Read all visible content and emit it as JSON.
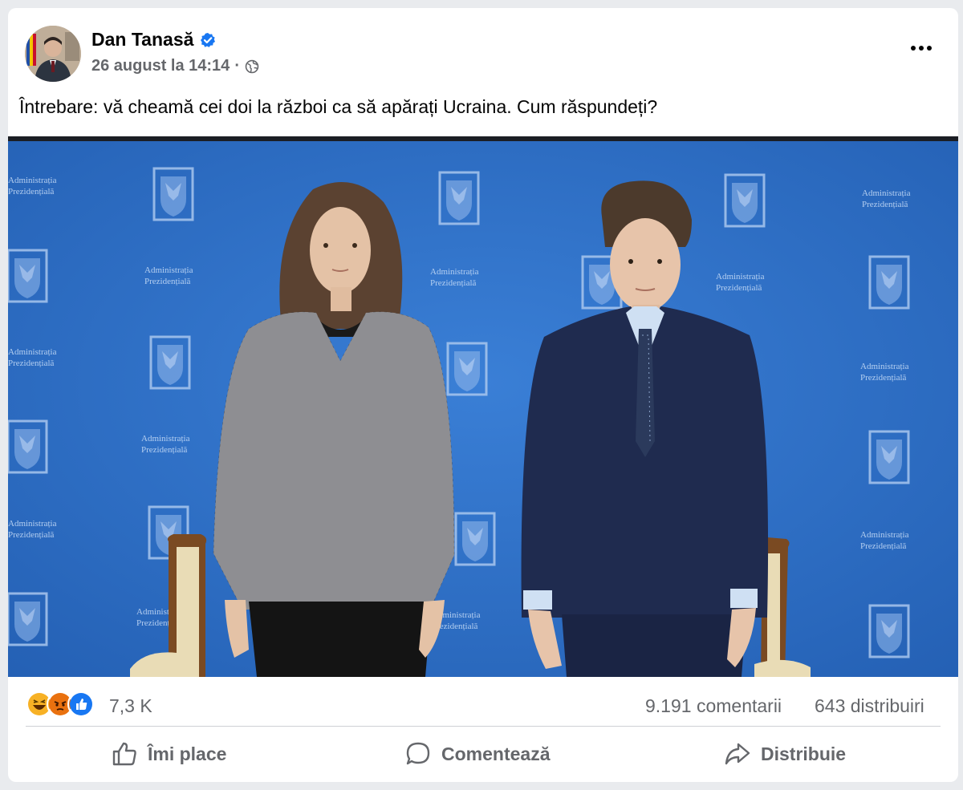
{
  "post": {
    "author": "Dan Tanasă",
    "timestamp": "26 august la 14:14",
    "separator": "·",
    "privacy_icon": "globe-icon",
    "verified_icon": "verified-badge-icon",
    "more_icon": "more-options-icon",
    "message": "Întrebare: vă cheamă cei doi la război ca să apărați Ucraina. Cum răspundeți?"
  },
  "photo": {
    "backdrop_text_line1": "Administrația",
    "backdrop_text_line2": "Prezidențială",
    "backdrop_color": "#2e6fc7"
  },
  "stats": {
    "reaction_icons": [
      "haha-icon",
      "angry-icon",
      "like-icon"
    ],
    "reactions_count": "7,3 K",
    "comments": "9.191 comentarii",
    "shares": "643 distribuiri"
  },
  "actions": {
    "like": "Îmi place",
    "comment": "Comentează",
    "share": "Distribuie"
  },
  "colors": {
    "accent": "#1877f2",
    "secondary_text": "#65676b",
    "haha": "#f7b125",
    "angry": "#e9710f"
  }
}
